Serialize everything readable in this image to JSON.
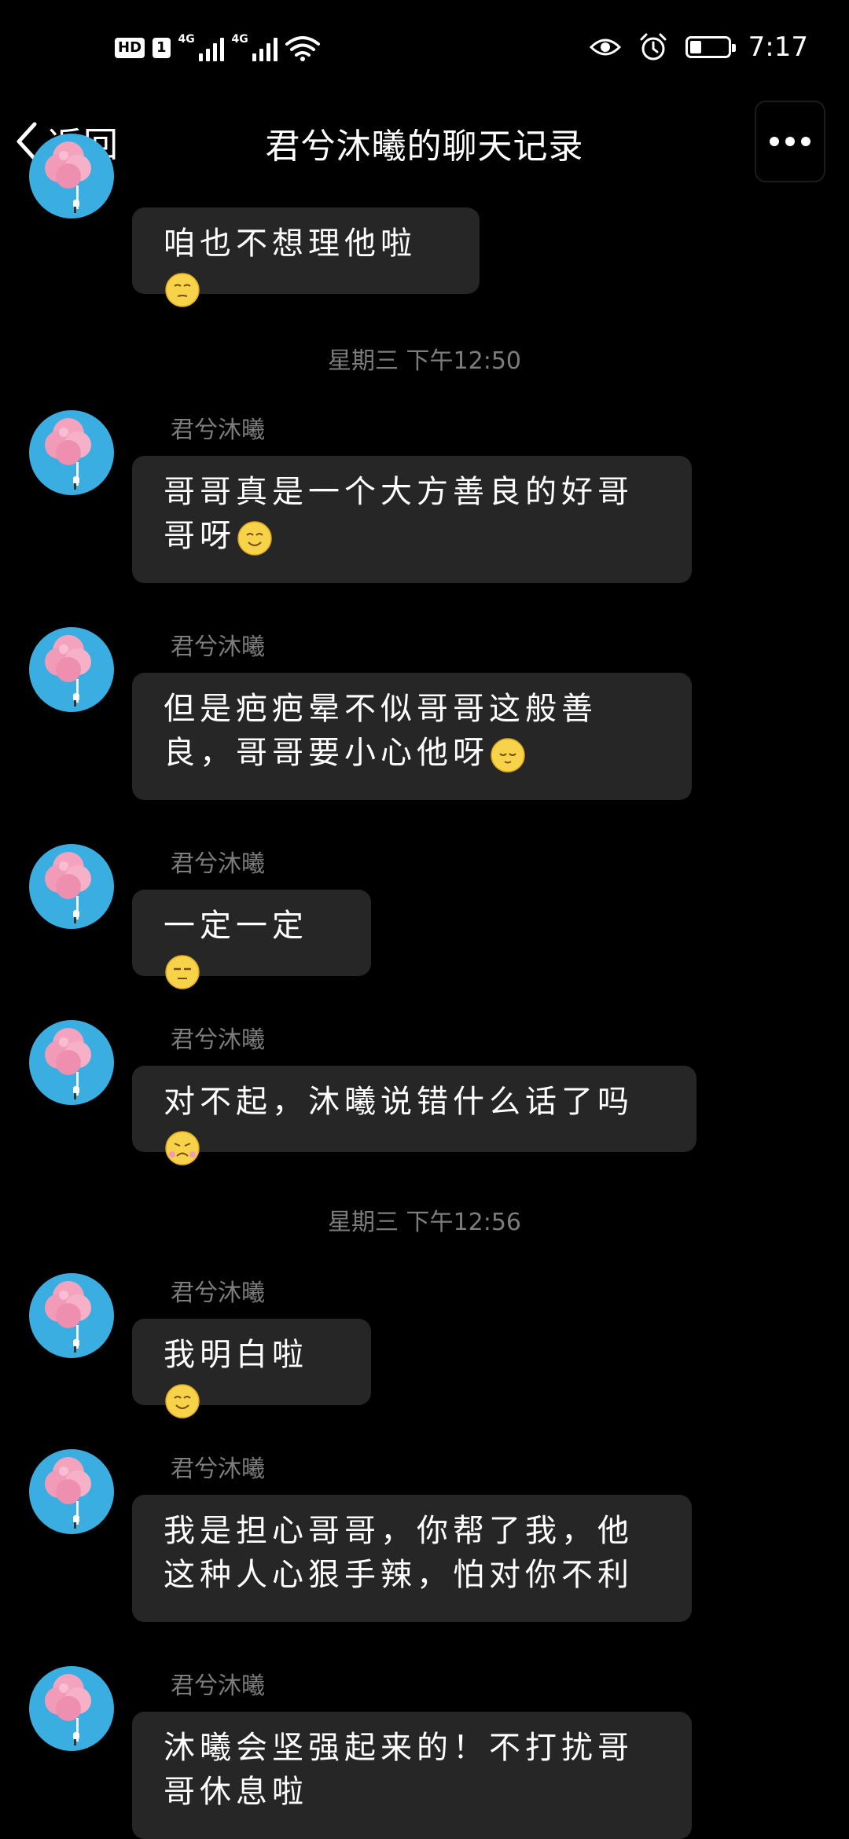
{
  "status_bar": {
    "hd": "HD",
    "sim": "1",
    "net1": "4G",
    "net2": "4G",
    "time": "7:17",
    "battery_level": 0.3
  },
  "nav": {
    "back_label": "返回",
    "title": "君兮沐曦的聊天记录"
  },
  "colors": {
    "background": "#000000",
    "bubble": "#262626",
    "secondary_text": "#7d7d7d",
    "avatar_bg": "#3aaee0",
    "cotton_candy": "#f29bb8"
  },
  "messages": [
    {
      "text": "咱也不想理他啦",
      "emoji": "smirk-emoji"
    },
    {
      "sender": "君兮沐曦",
      "text": "哥哥真是一个大方善良的好哥哥呀",
      "emoji": "smile-emoji"
    },
    {
      "sender": "君兮沐曦",
      "text": "但是疤疤晕不似哥哥这般善良，哥哥要小心他呀",
      "emoji": "relieved-emoji"
    },
    {
      "sender": "君兮沐曦",
      "text": "一定一定",
      "emoji": "unamused-emoji"
    },
    {
      "sender": "君兮沐曦",
      "text": "对不起，沐曦说错什么话了吗",
      "emoji": "sad-emoji"
    },
    {
      "sender": "君兮沐曦",
      "text": "我明白啦",
      "emoji": "smile-emoji"
    },
    {
      "sender": "君兮沐曦",
      "text": "我是担心哥哥，你帮了我，他这种人心狠手辣，怕对你不利"
    },
    {
      "sender": "君兮沐曦",
      "text": "沐曦会坚强起来的！不打扰哥哥休息啦"
    }
  ],
  "timestamps": [
    "星期三 下午12:50",
    "星期三 下午12:56"
  ]
}
